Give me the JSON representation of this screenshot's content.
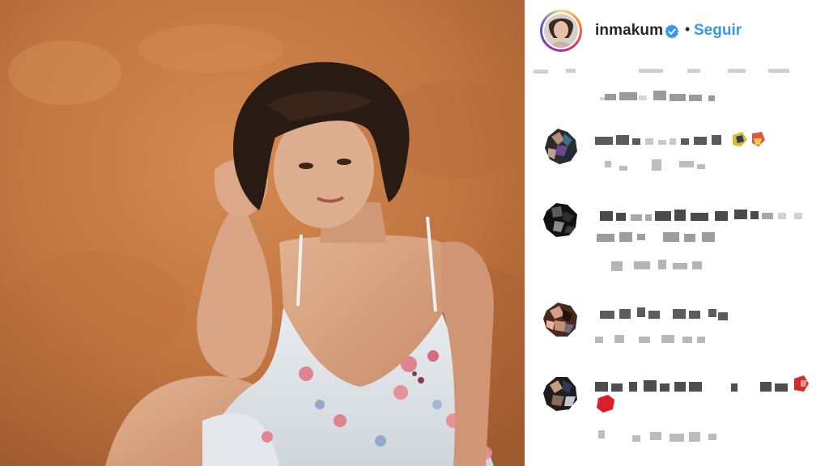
{
  "post": {
    "username": "inmakum",
    "separator": "•",
    "follow_label": "Seguir"
  },
  "icons": {
    "verified": "verified-badge-icon"
  },
  "colors": {
    "follow_blue": "#3897f0",
    "verified_blue": "#3897f0",
    "text_dark": "#262626",
    "backdrop": "#c57a44"
  }
}
